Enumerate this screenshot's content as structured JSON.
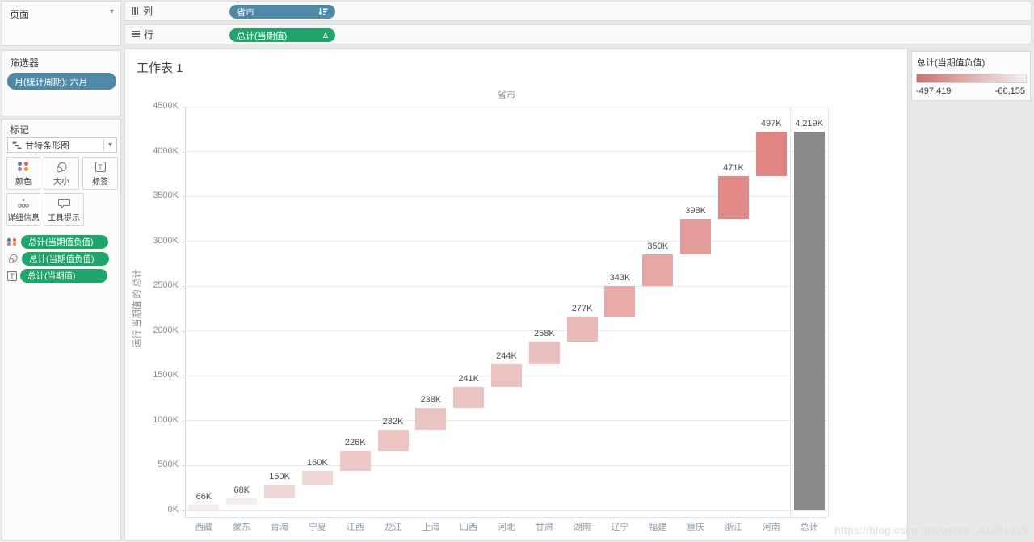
{
  "left_panel": {
    "pages": {
      "title": "页面"
    },
    "filters": {
      "title": "筛选器",
      "pill": "月(统计周期): 六月"
    },
    "marks": {
      "title": "标记",
      "mark_type": "甘特条形图",
      "buttons": [
        {
          "icon": "color-dots-icon",
          "label": "颜色"
        },
        {
          "icon": "size-circles-icon",
          "label": "大小"
        },
        {
          "icon": "text-label-icon",
          "label": "标签"
        },
        {
          "icon": "detail-dots-icon",
          "label": "详细信息"
        },
        {
          "icon": "tooltip-bubble-icon",
          "label": "工具提示"
        }
      ],
      "fields": [
        {
          "icon": "color-dots-icon",
          "label": "总计(当期值负值)"
        },
        {
          "icon": "size-circles-icon",
          "label": "总计(当期值负值)"
        },
        {
          "icon": "text-label-icon",
          "label": "总计(当期值)"
        }
      ]
    }
  },
  "shelves": {
    "columns": {
      "label": "列",
      "pill": "省市",
      "pill_icon": "sort-descending-icon"
    },
    "rows": {
      "label": "行",
      "pill": "总计(当期值)",
      "pill_icon": "delta-icon",
      "delta_glyph": "Δ"
    }
  },
  "sheet": {
    "title": "工作表 1",
    "column_header": "省市",
    "y_axis_title": "运行 当期值 的 总计"
  },
  "legend": {
    "title": "总计(当期值负值)",
    "min_label": "-497,419",
    "max_label": "-66,155",
    "gradient_start": "#c97470",
    "gradient_end": "#f2f0ef"
  },
  "colors": {
    "dimension_pill": "#4e8aa8",
    "measure_pill": "#1fa56c",
    "total_bar": "#8a8a8a",
    "bar_scale_light": "#f3eeed",
    "bar_scale_dark": "#e08481"
  },
  "watermark": "https://blog.csdn.net/weixin_41391619",
  "chart_data": {
    "type": "bar",
    "subtype": "waterfall_gantt",
    "title": "工作表 1",
    "column_header": "省市",
    "ylabel": "运行 当期值 的 总计",
    "categories": [
      "西藏",
      "蒙东",
      "青海",
      "宁夏",
      "江西",
      "龙江",
      "上海",
      "山西",
      "河北",
      "甘肃",
      "湖南",
      "辽宁",
      "福建",
      "重庆",
      "浙江",
      "河南",
      "总计"
    ],
    "values_k": [
      66,
      68,
      150,
      160,
      226,
      232,
      238,
      241,
      244,
      258,
      277,
      343,
      350,
      398,
      471,
      497,
      4219
    ],
    "bar_labels": [
      "66K",
      "68K",
      "150K",
      "160K",
      "226K",
      "232K",
      "238K",
      "241K",
      "244K",
      "258K",
      "277K",
      "343K",
      "350K",
      "398K",
      "471K",
      "497K",
      "4,219K"
    ],
    "total_index": 16,
    "y_tick_labels": [
      "0K",
      "500K",
      "1000K",
      "1500K",
      "2000K",
      "2500K",
      "3000K",
      "3500K",
      "4000K",
      "4500K"
    ],
    "y_ticks_k": [
      0,
      500,
      1000,
      1500,
      2000,
      2500,
      3000,
      3500,
      4000,
      4500
    ],
    "ylim_k": [
      0,
      4500
    ],
    "grid": true,
    "color_scale": {
      "min_value_k": 66,
      "max_value_k": 497
    },
    "legend_position": "top-right"
  }
}
